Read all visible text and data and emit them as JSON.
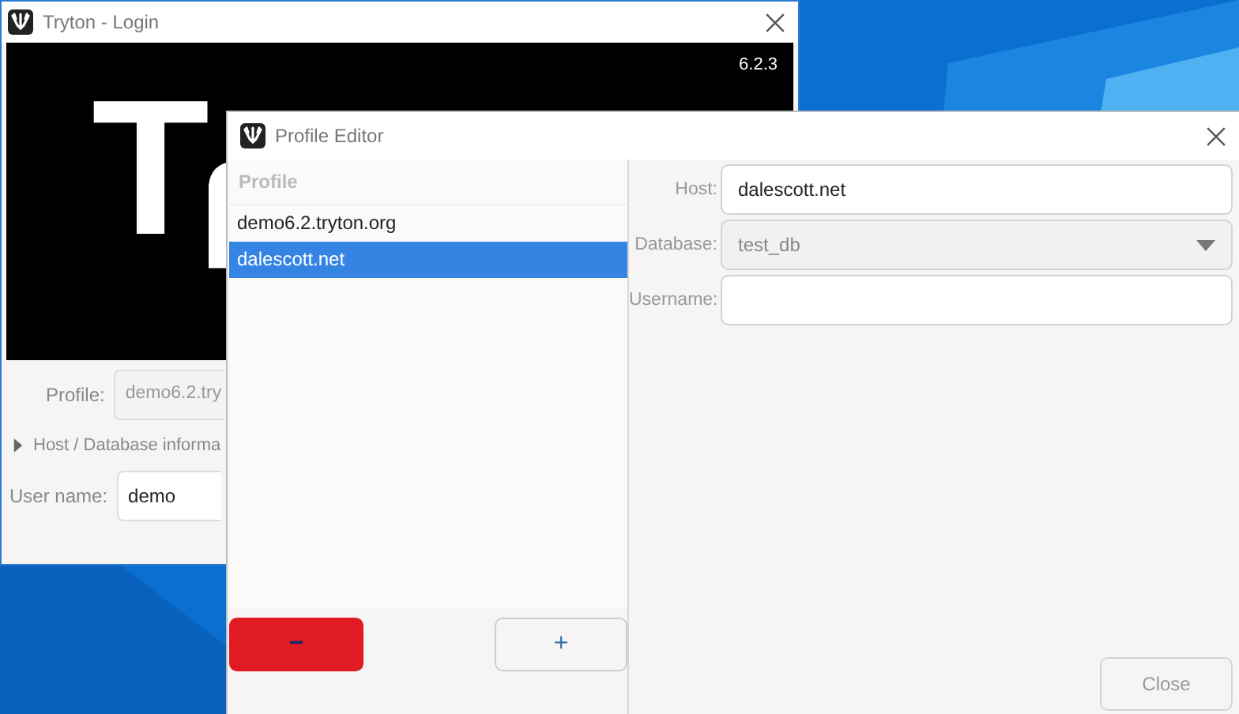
{
  "login_window": {
    "title": "Tryton - Login",
    "splash": {
      "version": "6.2.3",
      "logo_text": "T"
    },
    "profile": {
      "label": "Profile:",
      "value": "demo6.2.try"
    },
    "host_database": {
      "label": "Host / Database informa",
      "expanded": false
    },
    "user_name": {
      "label": "User name:",
      "value": "demo"
    }
  },
  "profile_editor": {
    "title": "Profile Editor",
    "profile_list": {
      "header": "Profile",
      "items": [
        {
          "label": "demo6.2.tryton.org",
          "selected": false
        },
        {
          "label": "dalescott.net",
          "selected": true
        }
      ]
    },
    "remove_button": "−",
    "add_button": "+",
    "fields": [
      {
        "kind": "text",
        "label": "Host:",
        "value": "dalescott.net",
        "disabled": false
      },
      {
        "kind": "dropdown",
        "label": "Database:",
        "value": "test_db",
        "disabled": true
      },
      {
        "kind": "text",
        "label": "Username:",
        "disabled": false
      }
    ],
    "close_button": "Close"
  }
}
